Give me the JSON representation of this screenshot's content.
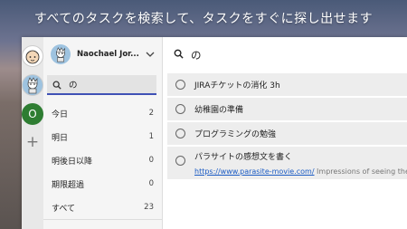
{
  "headline": "すべてのタスクを検索して、タスクをすぐに探し出せます",
  "rail": {
    "third_account_initial": "O",
    "add_label": "+"
  },
  "account": {
    "name": "Naochael Jor..."
  },
  "search": {
    "query": "の"
  },
  "lists": [
    {
      "label": "今日",
      "count": "2"
    },
    {
      "label": "明日",
      "count": "1"
    },
    {
      "label": "明後日以降",
      "count": "0"
    },
    {
      "label": "期限超過",
      "count": "0"
    },
    {
      "label": "すべて",
      "count": "23"
    }
  ],
  "main": {
    "query": "の",
    "tasks": [
      {
        "title": "JIRAチケットの消化 3h"
      },
      {
        "title": "幼稚園の準備"
      },
      {
        "title": "プログラミングの勉強"
      },
      {
        "title": "パラサイトの感想文を書く",
        "link": "https://www.parasite-movie.com/",
        "note": " Impressions of seeing the par"
      }
    ]
  },
  "colors": {
    "accent": "#3f51b5",
    "green_account": "#2e7d32",
    "link": "#1a5bc4"
  }
}
